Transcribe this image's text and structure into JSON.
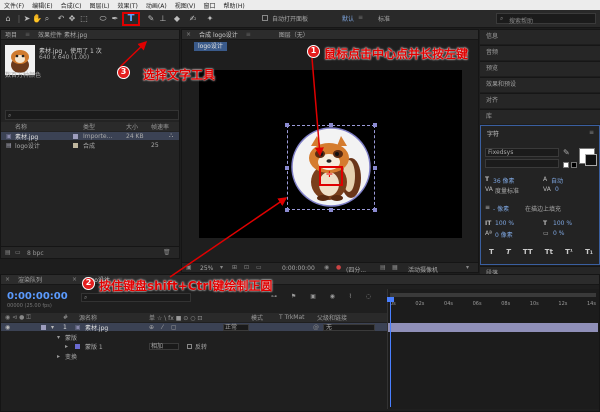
{
  "menu": [
    "文件(F)",
    "编辑(E)",
    "合成(C)",
    "图层(L)",
    "效果(T)",
    "动画(A)",
    "视图(V)",
    "窗口",
    "帮助(H)"
  ],
  "toolbar": {
    "auto_open_label": "自动打开面板",
    "default_label": "默认",
    "standard_label": "标准",
    "search_placeholder": "搜索帮助",
    "text_tool_glyph": "T"
  },
  "project": {
    "tab_project": "项目",
    "tab_effects": "效果控件 素材.jpg",
    "file_name": "素材.jpg",
    "file_usage": "，使用了 1 次",
    "file_dims": "640 x 640 (1.00)",
    "file_color": "数百万种颜色",
    "columns": [
      "名称",
      "类型",
      "大小",
      "帧速率"
    ],
    "items": [
      {
        "name": "素材.jpg",
        "type": "Importe...",
        "size": "24 KB",
        "fps": ""
      },
      {
        "name": "logo设计",
        "type": "合成",
        "size": "",
        "fps": "25"
      }
    ],
    "bpc": "8 bpc"
  },
  "comp": {
    "tab_comp": "合成 logo设计",
    "tab_layer": "图层（无）",
    "breadcrumb": "logo设计",
    "zoom": "25%",
    "timecode": "0:00:00:00",
    "quality": "(四分...",
    "camera": "活动摄像机"
  },
  "right_panel": {
    "tabs_top": [
      "信息",
      "音频",
      "预览",
      "效果和预设",
      "对齐",
      "库"
    ],
    "char_title": "字符",
    "font": "Fixedsys",
    "size": "36 像素",
    "leading": "自动",
    "tracking_label": "度量标准",
    "kerning": "0",
    "stroke": "- 像素",
    "stroke_opt": "在描边上填充",
    "vscale": "100 %",
    "hscale": "100 %",
    "baseline": "0 像素",
    "tsume": "0 %",
    "styles": [
      "T",
      "T",
      "TT",
      "Tt",
      "T¹",
      "T₁"
    ],
    "bottom_tab": "段落"
  },
  "timeline": {
    "tab_render": "渲染队列",
    "tab_comp": "logo设计",
    "timecode": "0:00:00:00",
    "frame_info": "00000 (25.00 fps)",
    "columns": [
      "#",
      "源名称",
      "单 ☆ \\ fx ■ ⊙ ○ ⊡",
      "模式",
      "T TrkMat",
      "父级和链接"
    ],
    "layers": [
      {
        "num": "1",
        "name": "素材.jpg",
        "mode": "正常",
        "parent": "无"
      }
    ],
    "sub_mask": "蒙版",
    "sub_mask1": "蒙版 1",
    "mask_mode": "相加",
    "mask_invert": "反转",
    "sub_transform": "变换",
    "ruler": [
      "0s",
      "02s",
      "04s",
      "06s",
      "08s",
      "10s",
      "12s",
      "14s"
    ]
  },
  "annotations": [
    {
      "num": "1",
      "text": "鼠标点击中心点并长按左键"
    },
    {
      "num": "2",
      "text": "按住键盘shift+Ctrl键绘制正圆"
    },
    {
      "num": "3",
      "text": "选择文字工具"
    }
  ],
  "colors": {
    "accent_red": "#e00000",
    "selection_blue": "#3b4254",
    "timecode_blue": "#5b9bff",
    "layer_bar": "#8f8fb8"
  }
}
